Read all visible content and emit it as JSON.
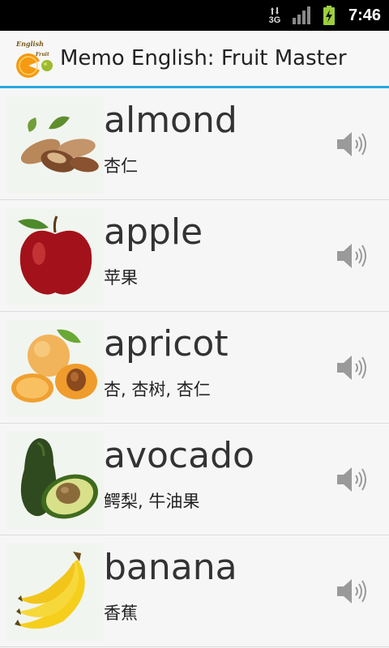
{
  "status_bar": {
    "network": "3G",
    "time": "7:46"
  },
  "header": {
    "app_title": "Memo English: Fruit Master",
    "logo_text_top": "English",
    "logo_text_bottom": "Fruit"
  },
  "words": [
    {
      "english": "almond",
      "chinese": "杏仁",
      "image_icon": "almond-image"
    },
    {
      "english": "apple",
      "chinese": "苹果",
      "image_icon": "apple-image"
    },
    {
      "english": "apricot",
      "chinese": "杏, 杏树, 杏仁",
      "image_icon": "apricot-image"
    },
    {
      "english": "avocado",
      "chinese": "鳄梨, 牛油果",
      "image_icon": "avocado-image"
    },
    {
      "english": "banana",
      "chinese": "香蕉",
      "image_icon": "banana-image"
    }
  ],
  "colors": {
    "accent": "#2aa8e2",
    "speaker": "#9a9a9a"
  }
}
